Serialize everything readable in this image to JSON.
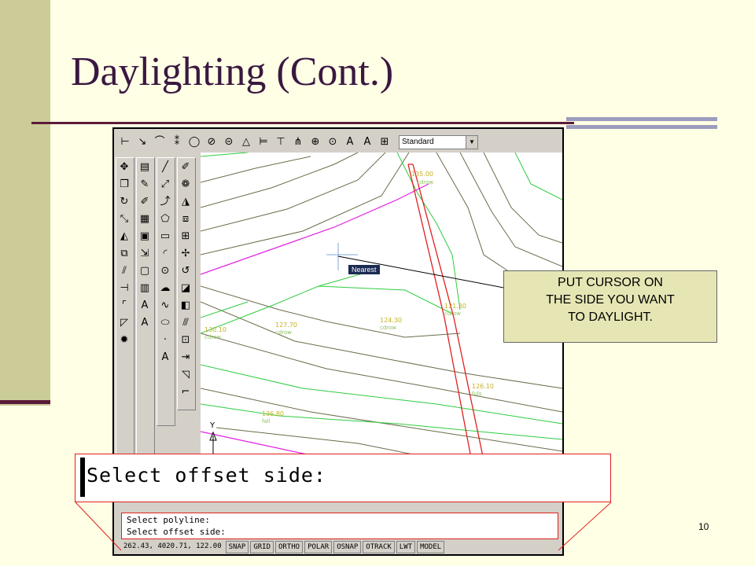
{
  "slide": {
    "title": "Daylighting (Cont.)",
    "page_number": "10"
  },
  "callout": {
    "lines": [
      "PUT CURSOR ON",
      "THE SIDE YOU WANT",
      "TO DAYLIGHT."
    ]
  },
  "screenshot": {
    "toolbar": {
      "style_select_value": "Standard",
      "icons": [
        "dimension-linear-icon",
        "dimension-aligned-icon",
        "dimension-arc-icon",
        "ordinate-icon",
        "radius-icon",
        "diameter-icon",
        "angular-icon",
        "quick-dim-icon",
        "baseline-icon",
        "continue-icon",
        "leader-icon",
        "tolerance-icon",
        "center-mark-icon",
        "dim-edit-icon",
        "dim-text-edit-icon",
        "dim-update-icon"
      ]
    },
    "tooltip": "Nearest",
    "drawing_labels": [
      {
        "value": "135.00",
        "tag": "cdrow"
      },
      {
        "value": "130.10",
        "tag": "cdrow"
      },
      {
        "value": "127.70",
        "tag": "cdrow"
      },
      {
        "value": "124.30",
        "tag": "cdrow"
      },
      {
        "value": "121.30",
        "tag": "cdrow"
      },
      {
        "value": "126.10",
        "tag": "fuls"
      },
      {
        "value": "136.80",
        "tag": "fall"
      }
    ],
    "ucs_label": "Y",
    "command_zoom_text": "Select offset side:",
    "command_lines": [
      "Select polyline:",
      "Select offset side:"
    ],
    "status_coords": "262.43, 4020.71, 122.00",
    "status_buttons": [
      "SNAP",
      "GRID",
      "ORTHO",
      "POLAR",
      "OSNAP",
      "OTRACK",
      "LWT",
      "MODEL"
    ]
  },
  "colors": {
    "left_bar": "#CCCC99",
    "accent_line": "#5C1B3A",
    "title_text": "#3A1840",
    "callout_bg": "#E6E6B5",
    "contour_green": "#2ECC40",
    "contour_gray": "#6B6B4B",
    "polyline_red": "#E0201E",
    "polyline_magenta": "#E020E0"
  }
}
